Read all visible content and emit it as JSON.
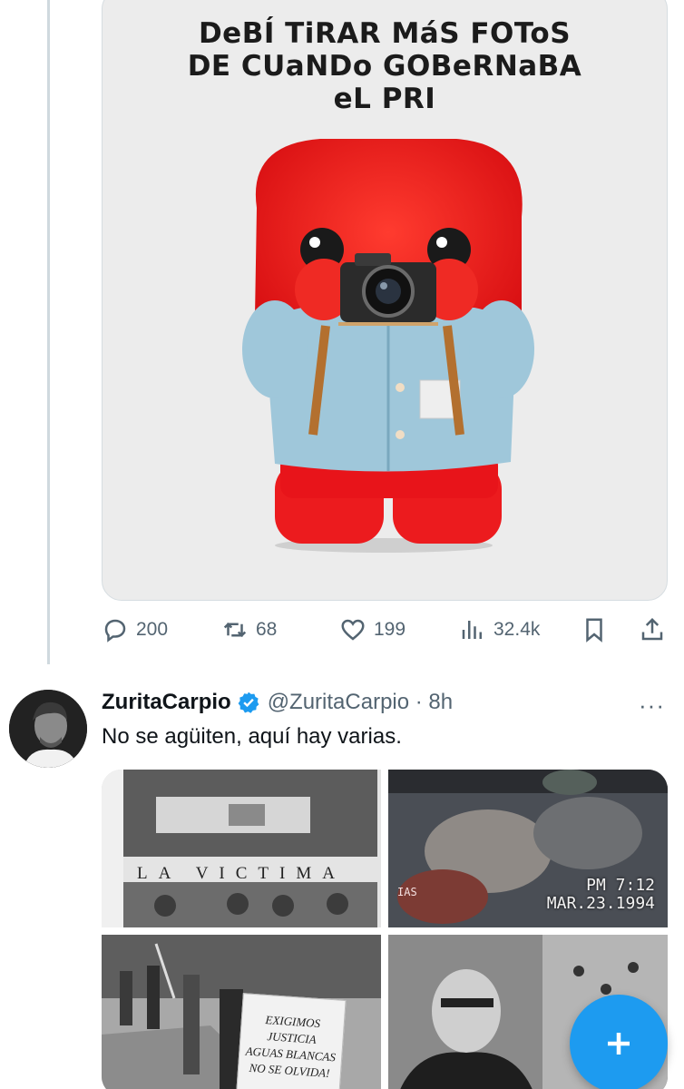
{
  "first_tweet": {
    "meme_text": [
      "DeBÍ TiRAR MáS FOToS",
      "DE CUaNDo GOBeRNaBA",
      "eL PRI"
    ],
    "actions": {
      "replies": "200",
      "retweets": "68",
      "likes": "199",
      "views": "32.4k"
    }
  },
  "second_tweet": {
    "name": "ZuritaCarpio",
    "handle_time": "@ZuritaCarpio · 8h",
    "text": "No se agüiten, aquí hay varias.",
    "more": "···",
    "images": {
      "victima_caption": "LA VICTIMA",
      "vhs_time": "PM 7:12",
      "vhs_date": "MAR.23.1994",
      "vhs_corner": "IAS",
      "sign_text": [
        "EXIGIMOS JUSTICIA",
        "AGUAS BLANCAS",
        "NO SE OLVIDA!"
      ]
    }
  },
  "colors": {
    "accent": "#1d9bf0",
    "icon_gray": "#536471",
    "mascot_red": "#e8141a",
    "jacket_blue": "#9fc7da"
  },
  "icons": [
    "reply-icon",
    "retweet-icon",
    "like-icon",
    "views-icon",
    "bookmark-icon",
    "share-icon",
    "verified-icon",
    "compose-icon"
  ]
}
